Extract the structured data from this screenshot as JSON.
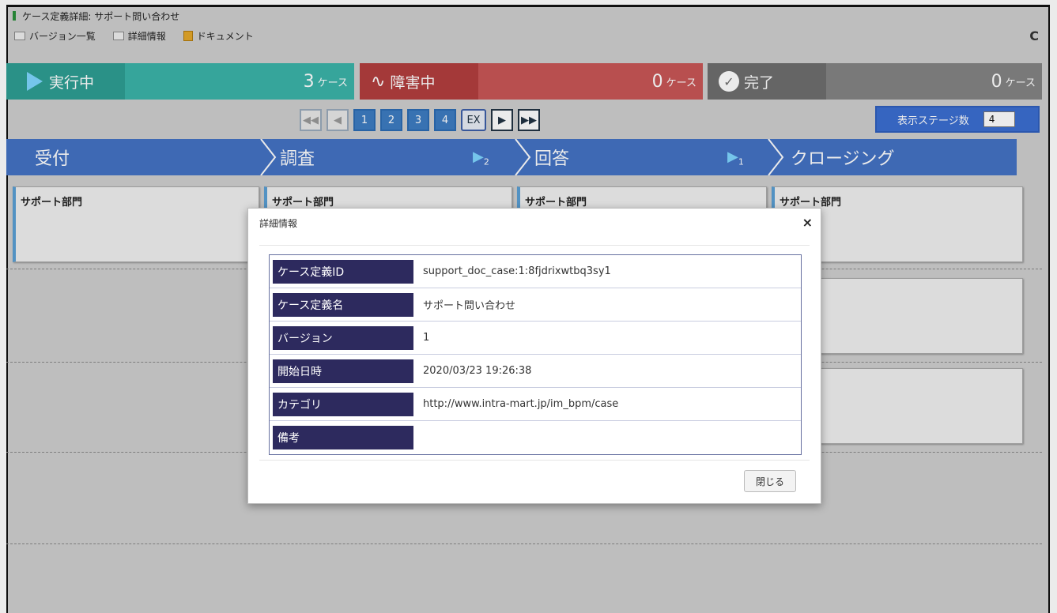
{
  "window": {
    "title": "ケース定義詳細: サポート問い合わせ"
  },
  "toolbar": {
    "version_list": "バージョン一覧",
    "details": "詳細情報",
    "document": "ドキュメント",
    "refresh": "C"
  },
  "status": {
    "running": {
      "label": "実行中",
      "count": "3",
      "unit": "ケース"
    },
    "error": {
      "label": "障害中",
      "count": "0",
      "unit": "ケース"
    },
    "done": {
      "label": "完了",
      "count": "0",
      "unit": "ケース"
    }
  },
  "pager": {
    "pages": [
      "1",
      "2",
      "3",
      "4"
    ],
    "ex": "EX",
    "first": "◀◀",
    "prev": "◀",
    "next": "▶",
    "last": "▶▶"
  },
  "stage_count": {
    "label": "表示ステージ数",
    "value": "4"
  },
  "stages": [
    {
      "label": "受付",
      "count": ""
    },
    {
      "label": "調査",
      "count": "2"
    },
    {
      "label": "回答",
      "count": "1"
    },
    {
      "label": "クロージング",
      "count": ""
    }
  ],
  "cards": {
    "dept": "サポート部門",
    "partial": "門"
  },
  "modal": {
    "title": "詳細情報",
    "close_icon": "×",
    "rows": [
      {
        "key": "ケース定義ID",
        "value": "support_doc_case:1:8fjdrixwtbq3sy1"
      },
      {
        "key": "ケース定義名",
        "value": "サポート問い合わせ"
      },
      {
        "key": "バージョン",
        "value": "1"
      },
      {
        "key": "開始日時",
        "value": "2020/03/23 19:26:38"
      },
      {
        "key": "カテゴリ",
        "value": "http://www.intra-mart.jp/im_bpm/case"
      },
      {
        "key": "備考",
        "value": ""
      }
    ],
    "close_button": "閉じる"
  }
}
